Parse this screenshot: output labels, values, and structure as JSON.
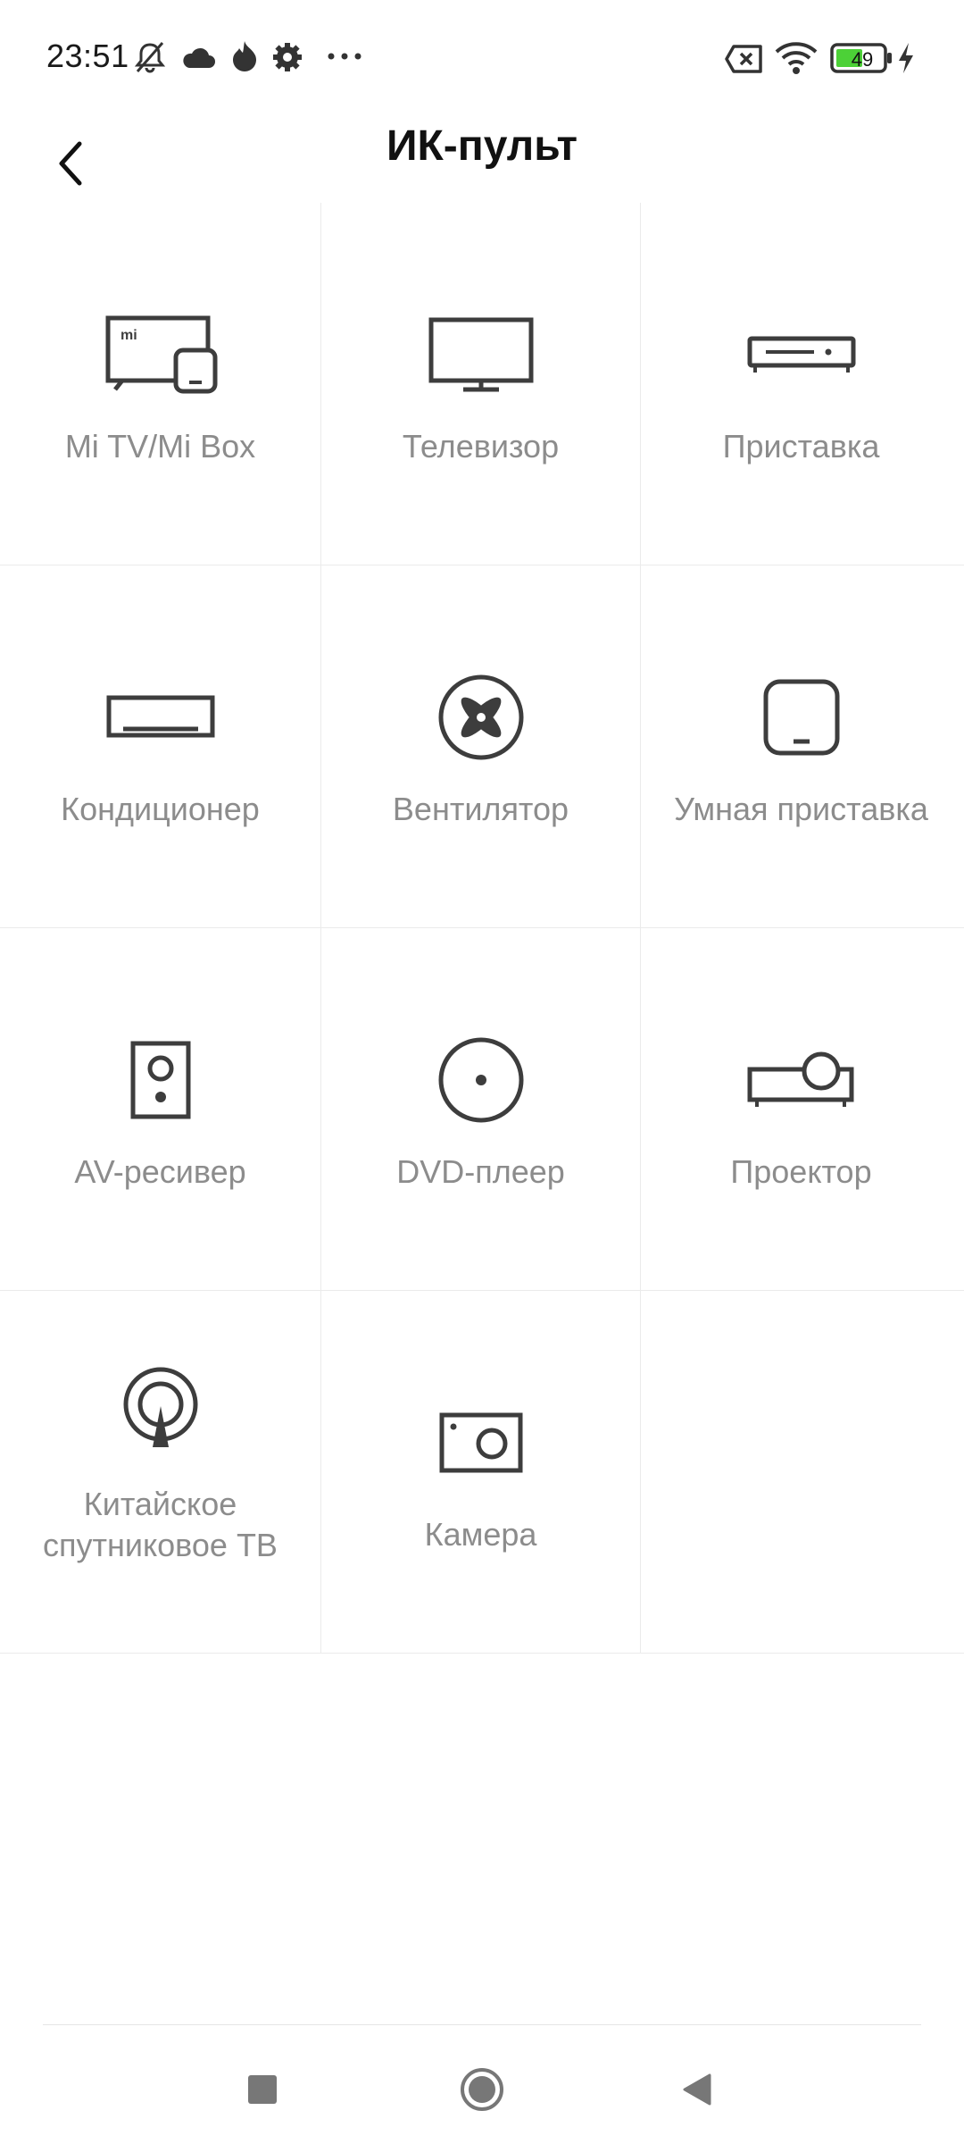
{
  "status_bar": {
    "time": "23:51",
    "battery_level": "49",
    "icons": [
      "mute-icon",
      "cloud-icon",
      "flame-icon",
      "gear-icon",
      "more-dots-icon",
      "sim-x-icon",
      "wifi-icon",
      "battery-icon",
      "charging-icon"
    ]
  },
  "header": {
    "title": "ИК-пульт",
    "back_icon": "chevron-left-icon"
  },
  "devices": [
    {
      "label": "Mi TV/Mi Box",
      "icon": "mi-tv-box-icon"
    },
    {
      "label": "Телевизор",
      "icon": "tv-icon"
    },
    {
      "label": "Приставка",
      "icon": "settop-box-icon"
    },
    {
      "label": "Кондиционер",
      "icon": "air-conditioner-icon"
    },
    {
      "label": "Вентилятор",
      "icon": "fan-icon"
    },
    {
      "label": "Умная приставка",
      "icon": "smart-box-icon"
    },
    {
      "label": "AV-ресивер",
      "icon": "speaker-icon"
    },
    {
      "label": "DVD-плеер",
      "icon": "disc-icon"
    },
    {
      "label": "Проектор",
      "icon": "projector-icon"
    },
    {
      "label": "Китайское\nспутниковое ТВ",
      "icon": "satellite-icon"
    },
    {
      "label": "Камера",
      "icon": "camera-icon"
    }
  ],
  "nav": {
    "icons": [
      "recents-square-icon",
      "home-circle-icon",
      "back-triangle-icon"
    ]
  },
  "colors": {
    "icon": "#3d3d3d",
    "label": "#8c8c8c",
    "divider": "#ebebeb",
    "battery_fill": "#4cd137"
  }
}
